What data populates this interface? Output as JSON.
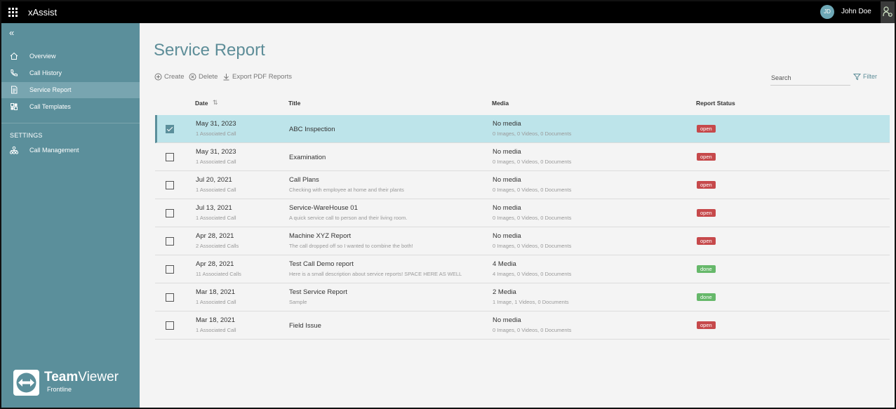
{
  "app": {
    "title": "xAssist",
    "user_initials": "JD",
    "user_name": "John Doe"
  },
  "sidebar": {
    "items": [
      {
        "label": "Overview",
        "icon": "home-icon"
      },
      {
        "label": "Call History",
        "icon": "phone-icon"
      },
      {
        "label": "Service Report",
        "icon": "document-icon",
        "active": true
      },
      {
        "label": "Call Templates",
        "icon": "template-icon"
      }
    ],
    "settings_heading": "SETTINGS",
    "settings_items": [
      {
        "label": "Call Management",
        "icon": "org-chart-icon"
      }
    ],
    "brand_team": "Team",
    "brand_viewer": "Viewer",
    "brand_sub": "Frontline"
  },
  "main": {
    "title": "Service Report",
    "toolbar": {
      "create": "Create",
      "delete": "Delete",
      "export": "Export PDF Reports"
    },
    "search_label": "Search",
    "filter_label": "Filter",
    "columns": {
      "date": "Date",
      "title": "Title",
      "media": "Media",
      "status": "Report Status"
    },
    "rows": [
      {
        "date": "May 31, 2023",
        "calls": "1 Associated Call",
        "title": "ABC Inspection",
        "desc": "",
        "media": "No media",
        "media_sub": "0 Images, 0 Videos, 0 Documents",
        "status": "open",
        "selected": true
      },
      {
        "date": "May 31, 2023",
        "calls": "1 Associated Call",
        "title": "Examination",
        "desc": "",
        "media": "No media",
        "media_sub": "0 Images, 0 Videos, 0 Documents",
        "status": "open",
        "selected": false
      },
      {
        "date": "Jul 20, 2021",
        "calls": "1 Associated Call",
        "title": "Call Plans",
        "desc": "Checking with employee at home and their plants",
        "media": "No media",
        "media_sub": "0 Images, 0 Videos, 0 Documents",
        "status": "open",
        "selected": false
      },
      {
        "date": "Jul 13, 2021",
        "calls": "1 Associated Call",
        "title": "Service-WareHouse 01",
        "desc": "A quick service call to person and their living room.",
        "media": "No media",
        "media_sub": "0 Images, 0 Videos, 0 Documents",
        "status": "open",
        "selected": false
      },
      {
        "date": "Apr 28, 2021",
        "calls": "2 Associated Calls",
        "title": "Machine XYZ Report",
        "desc": "The call dropped off so I wanted to combine the both!",
        "media": "No media",
        "media_sub": "0 Images, 0 Videos, 0 Documents",
        "status": "open",
        "selected": false
      },
      {
        "date": "Apr 28, 2021",
        "calls": "11 Associated Calls",
        "title": "Test Call Demo report",
        "desc": "Here is a small description about service reports! SPACE HERE AS WELL",
        "media": "4 Media",
        "media_sub": "4 Images, 0 Videos, 0 Documents",
        "status": "done",
        "selected": false
      },
      {
        "date": "Mar 18, 2021",
        "calls": "1 Associated Call",
        "title": "Test Service Report",
        "desc": "Sample",
        "media": "2 Media",
        "media_sub": "1 Image, 1 Videos, 0 Documents",
        "status": "done",
        "selected": false
      },
      {
        "date": "Mar 18, 2021",
        "calls": "1 Associated Call",
        "title": "Field Issue",
        "desc": "",
        "media": "No media",
        "media_sub": "0 Images, 0 Videos, 0 Documents",
        "status": "open",
        "selected": false
      }
    ]
  },
  "colors": {
    "sidebar_bg": "#5b8f9b",
    "sidebar_active": "#78a5b0",
    "accent": "#5d8d98",
    "selected_row": "#bde4ea",
    "status_open": "#c6494b",
    "status_done": "#66b86a"
  }
}
